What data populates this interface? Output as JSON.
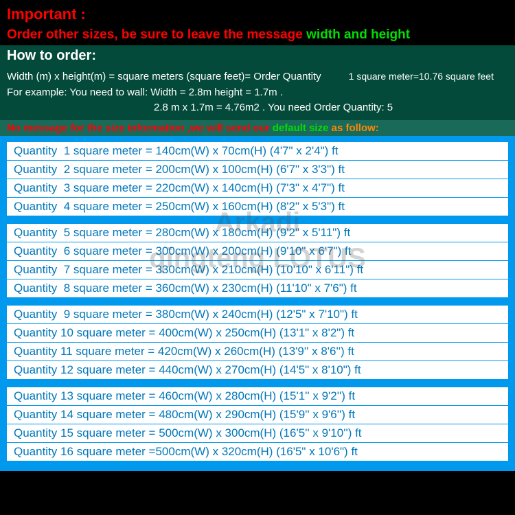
{
  "important_label": "Important :",
  "order_message": {
    "text": "Order other sizes, be sure to leave the message ",
    "highlight": "width and height"
  },
  "how_to_order_header": "How to order:",
  "formula": {
    "line1_left": "Width (m) x height(m) = square meters (square feet)= Order Quantity",
    "line1_right": "1 square meter=10.76 square feet",
    "line2": "For example: You need to wall: Width = 2.8m     height = 1.7m .",
    "line3": "2.8 m x 1.7m = 4.76m2 . You need Order Quantity: 5"
  },
  "no_message": {
    "red": "No message for the size information ,we will send our ",
    "green": "default size ",
    "orange": "as follow:"
  },
  "watermark": {
    "line1": "Arkadi",
    "line2": "qingteng LOTUS"
  },
  "chart_data": {
    "type": "table",
    "title": "Quantity to Size Mapping",
    "groups": [
      {
        "rows": [
          {
            "qty": 1,
            "w_cm": 140,
            "h_cm": 70,
            "ft": "(4'7\" x 2'4\") ft"
          },
          {
            "qty": 2,
            "w_cm": 200,
            "h_cm": 100,
            "ft": "(6'7\" x 3'3\") ft"
          },
          {
            "qty": 3,
            "w_cm": 220,
            "h_cm": 140,
            "ft": "(7'3\" x 4'7\") ft"
          },
          {
            "qty": 4,
            "w_cm": 250,
            "h_cm": 160,
            "ft": "(8'2\" x 5'3\") ft"
          }
        ]
      },
      {
        "rows": [
          {
            "qty": 5,
            "w_cm": 280,
            "h_cm": 180,
            "ft": "(9'2\" x 5'11\") ft"
          },
          {
            "qty": 6,
            "w_cm": 300,
            "h_cm": 200,
            "ft": "(9'10\" x 6'7\") ft"
          },
          {
            "qty": 7,
            "w_cm": 330,
            "h_cm": 210,
            "ft": "(10'10\" x 6'11\") ft"
          },
          {
            "qty": 8,
            "w_cm": 360,
            "h_cm": 230,
            "ft": "(11'10\" x 7'6\") ft"
          }
        ]
      },
      {
        "rows": [
          {
            "qty": 9,
            "w_cm": 380,
            "h_cm": 240,
            "ft": "(12'5\" x 7'10\") ft"
          },
          {
            "qty": 10,
            "w_cm": 400,
            "h_cm": 250,
            "ft": "(13'1\" x 8'2\") ft"
          },
          {
            "qty": 11,
            "w_cm": 420,
            "h_cm": 260,
            "ft": "(13'9'' x 8'6'') ft"
          },
          {
            "qty": 12,
            "w_cm": 440,
            "h_cm": 270,
            "ft": "(14'5\" x 8'10\") ft"
          }
        ]
      },
      {
        "rows": [
          {
            "qty": 13,
            "w_cm": 460,
            "h_cm": 280,
            "ft": "(15'1'' x 9'2'') ft"
          },
          {
            "qty": 14,
            "w_cm": 480,
            "h_cm": 290,
            "ft": "(15'9'' x 9'6'') ft"
          },
          {
            "qty": 15,
            "w_cm": 500,
            "h_cm": 300,
            "ft": "(16'5'' x 9'10'') ft"
          },
          {
            "qty": 16,
            "w_cm": 500,
            "h_cm": 320,
            "ft": "(16'5\" x 10'6\") ft"
          }
        ]
      }
    ]
  }
}
